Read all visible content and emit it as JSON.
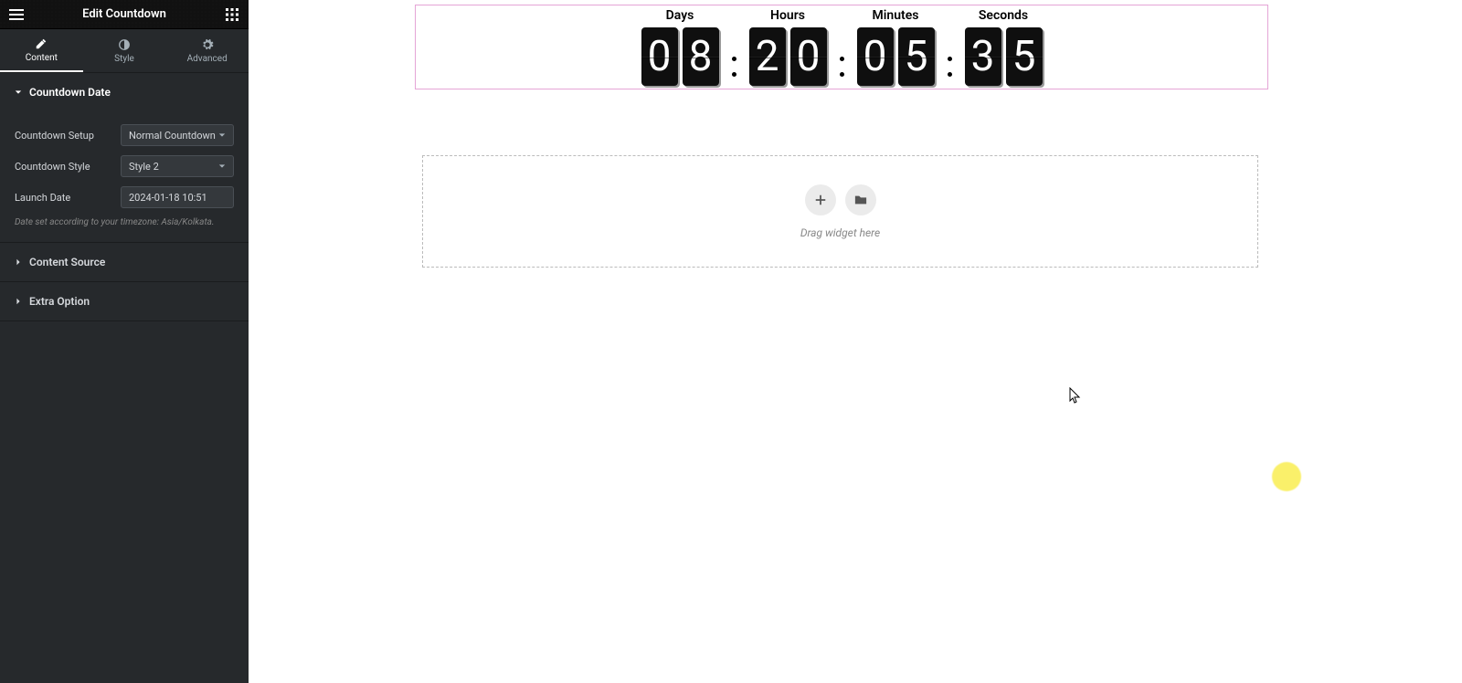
{
  "header": {
    "title": "Edit Countdown"
  },
  "tabs": {
    "content": "Content",
    "style": "Style",
    "advanced": "Advanced"
  },
  "sections": {
    "countdown_date": {
      "title": "Countdown Date",
      "setup_lbl": "Countdown Setup",
      "setup_val": "Normal Countdown",
      "style_lbl": "Countdown Style",
      "style_val": "Style 2",
      "launch_lbl": "Launch Date",
      "launch_val": "2024-01-18 10:51",
      "tz_note": "Date set according to your timezone: Asia/Kolkata."
    },
    "content_source": {
      "title": "Content Source"
    },
    "extra_option": {
      "title": "Extra Option"
    }
  },
  "countdown": {
    "days_lbl": "Days",
    "hours_lbl": "Hours",
    "minutes_lbl": "Minutes",
    "seconds_lbl": "Seconds",
    "days": [
      "0",
      "8"
    ],
    "hours": [
      "2",
      "0"
    ],
    "minutes": [
      "0",
      "5"
    ],
    "seconds": [
      "3",
      "5"
    ]
  },
  "dropzone": {
    "text": "Drag widget here"
  }
}
